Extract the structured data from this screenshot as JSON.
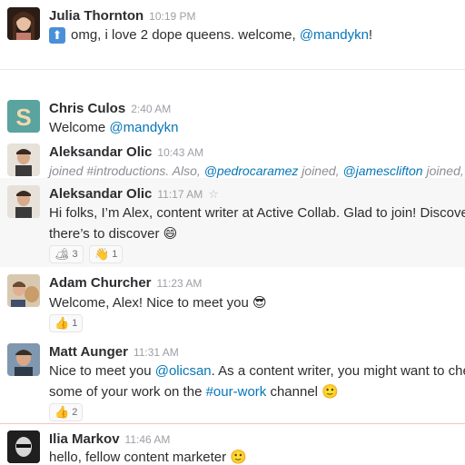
{
  "messages": [
    {
      "name": "Julia Thornton",
      "time": "10:19 PM",
      "text_pre": "omg, i love 2 dope queens. welcome, ",
      "mention": "@mandykn",
      "text_post": "!"
    },
    {
      "name": "Chris Culos",
      "time": "2:40 AM",
      "text_pre": "Welcome ",
      "mention": "@mandykn",
      "avatar_letter": "S"
    },
    {
      "name": "Aleksandar Olic",
      "time": "10:43 AM",
      "join_pre": "joined #introductions. Also, ",
      "m1": "@pedrocaramez",
      "join_mid": " joined, ",
      "m2": "@jamesclifton",
      "join_post": " joined, @"
    },
    {
      "name": "Aleksandar Olic",
      "time": "11:17 AM",
      "line1": "Hi folks, I’m Alex, content writer at Active Collab. Glad to join! Discover",
      "line2": "there’s to discover 😄",
      "reactions": [
        {
          "emoji": "🏕",
          "count": "3"
        },
        {
          "emoji": "👋",
          "count": "1"
        }
      ]
    },
    {
      "name": "Adam Churcher",
      "time": "11:23 AM",
      "text": "Welcome, Alex! Nice to meet you 😎",
      "reactions": [
        {
          "emoji": "👍",
          "count": "1"
        }
      ]
    },
    {
      "name": "Matt Aunger",
      "time": "11:31 AM",
      "l1_pre": "Nice to meet you ",
      "l1_mention": "@olicsan",
      "l1_post": ". As a content writer, you might want to che",
      "l2_pre": "some of your work on the ",
      "l2_channel": "#our-work",
      "l2_post": " channel 🙂",
      "reactions": [
        {
          "emoji": "👍",
          "count": "2"
        }
      ]
    },
    {
      "name": "Ilia Markov",
      "time": "11:46 AM",
      "text": "hello, fellow content marketer 🙂"
    }
  ],
  "icons": {
    "upvote": "up-arrow-icon",
    "star": "star-icon"
  }
}
